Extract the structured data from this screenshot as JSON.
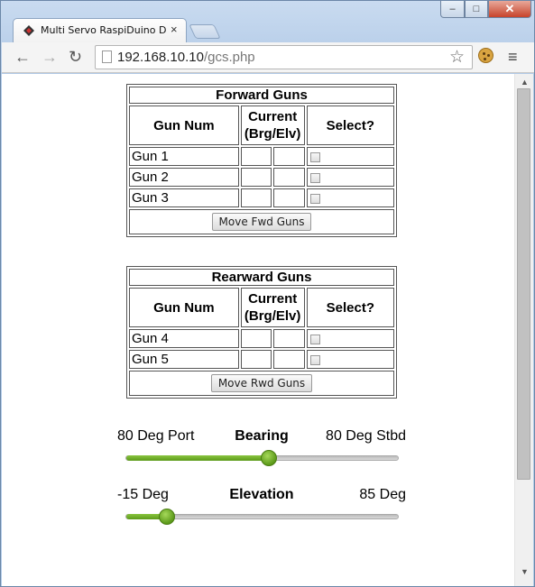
{
  "tab": {
    "title": "Multi Servo RaspiDuino Da",
    "close": "×"
  },
  "window_controls": {
    "minimize": "–",
    "maximize": "□",
    "close": "✕"
  },
  "toolbar": {
    "back_icon": "←",
    "forward_icon": "→",
    "reload_icon": "↻",
    "url_host": "192.168.10.10",
    "url_path": "/gcs.php",
    "star_icon": "☆",
    "menu_icon": "≡"
  },
  "forward": {
    "title": "Forward Guns",
    "col_num": "Gun Num",
    "col_current": "Current (Brg/Elv)",
    "col_select": "Select?",
    "guns": [
      "Gun 1",
      "Gun 2",
      "Gun 3"
    ],
    "button": "Move Fwd Guns"
  },
  "rearward": {
    "title": "Rearward Guns",
    "col_num": "Gun Num",
    "col_current": "Current (Brg/Elv)",
    "col_select": "Select?",
    "guns": [
      "Gun 4",
      "Gun 5"
    ],
    "button": "Move Rwd Guns"
  },
  "bearing": {
    "left": "80 Deg Port",
    "label": "Bearing",
    "right": "80 Deg Stbd",
    "min": -80,
    "max": 80,
    "value": 4
  },
  "elevation": {
    "left": "-15 Deg",
    "label": "Elevation",
    "right": "85 Deg",
    "min": -15,
    "max": 85,
    "value": 0
  },
  "colors": {
    "accent": "#6aa624",
    "frame": "#b5cbe6"
  }
}
